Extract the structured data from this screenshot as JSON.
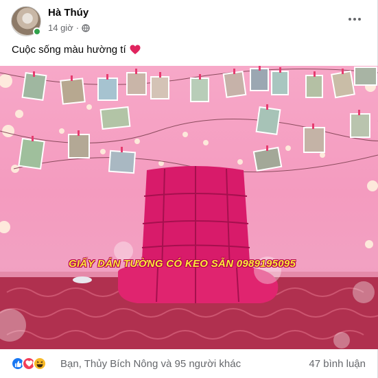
{
  "post": {
    "author": "Hà Thúy",
    "time": "14 giờ",
    "meta_separator": "·",
    "caption": "Cuộc sống màu hường tí",
    "caption_emoji": "heart-emoji",
    "photo": {
      "watermark": "GIẤY DÁN TƯỜNG CÓ KEO SẴN 0989195095"
    },
    "reactions": {
      "icons": [
        "like-icon",
        "love-icon",
        "haha-icon"
      ],
      "summary": "Bạn, Thủy Bích Nông và 95 người khác"
    },
    "comments": "47 bình luận"
  },
  "colors": {
    "wall": "#f49bbf",
    "cushion": "#d81b6a",
    "like": "#1877f2",
    "love": "#f33e58",
    "haha": "#f7b928",
    "online": "#31a24c",
    "secondary_text": "#65676b"
  }
}
